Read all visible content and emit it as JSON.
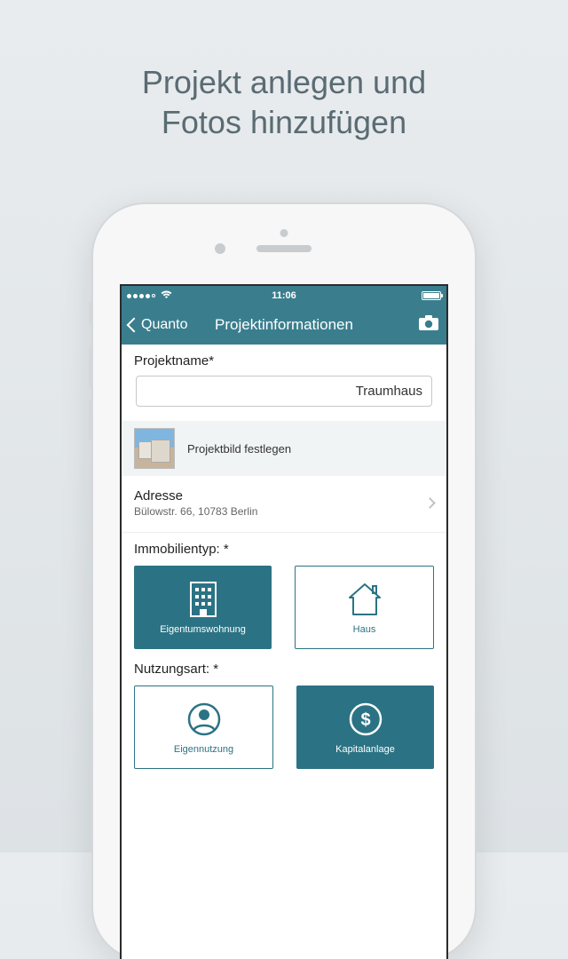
{
  "promo": {
    "line1": "Projekt anlegen und",
    "line2": "Fotos hinzufügen"
  },
  "status": {
    "time": "11:06"
  },
  "nav": {
    "back_label": "Quanto",
    "title": "Projektinformationen"
  },
  "form": {
    "projectname_label": "Projektname*",
    "projectname_value": "Traumhaus",
    "projectimage_label": "Projektbild festlegen",
    "address_label": "Adresse",
    "address_value": "Bülowstr.  66, 10783 Berlin",
    "property_type_label": "Immobilientyp: *",
    "property_types": [
      {
        "label": "Eigentumswohnung",
        "selected": true
      },
      {
        "label": "Haus",
        "selected": false
      }
    ],
    "usage_label": "Nutzungsart: *",
    "usage_types": [
      {
        "label": "Eigennutzung",
        "selected": false
      },
      {
        "label": "Kapitalanlage",
        "selected": true
      }
    ]
  },
  "colors": {
    "accent": "#3a7e8e",
    "tile": "#2b7384"
  }
}
